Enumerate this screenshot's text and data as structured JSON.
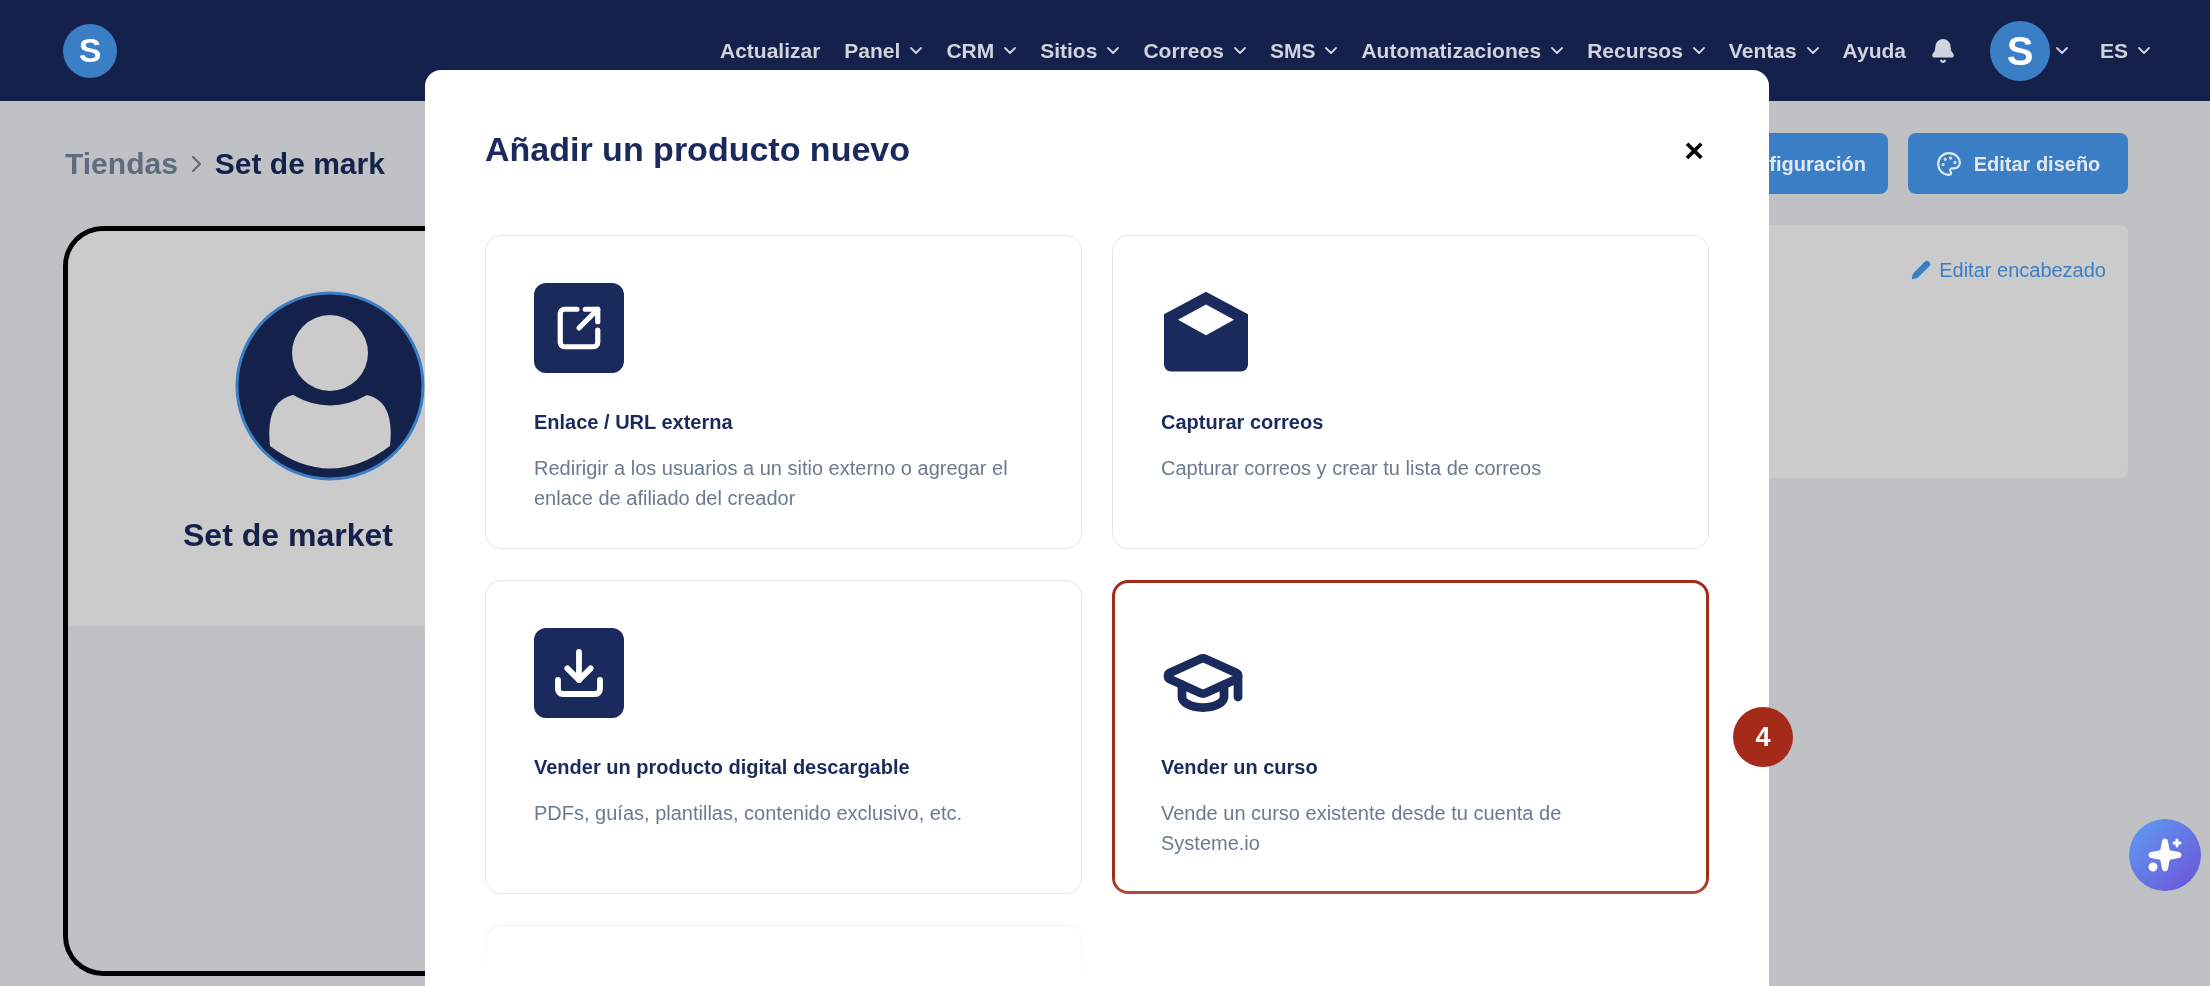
{
  "nav": {
    "items": [
      {
        "label": "Actualizar",
        "dropdown": false
      },
      {
        "label": "Panel",
        "dropdown": true
      },
      {
        "label": "CRM",
        "dropdown": true
      },
      {
        "label": "Sitios",
        "dropdown": true
      },
      {
        "label": "Correos",
        "dropdown": true
      },
      {
        "label": "SMS",
        "dropdown": true
      },
      {
        "label": "Automatizaciones",
        "dropdown": true
      },
      {
        "label": "Recursos",
        "dropdown": true
      },
      {
        "label": "Ventas",
        "dropdown": true
      },
      {
        "label": "Ayuda",
        "dropdown": false
      }
    ],
    "logo": "S",
    "avatar": "S",
    "language": "ES"
  },
  "breadcrumb": [
    "Tiendas",
    "Set de mark"
  ],
  "store_card": {
    "title": "Set de market"
  },
  "actions": [
    "figuración",
    "Editar diseño"
  ],
  "header_panel": {
    "link": "Editar encabezado"
  },
  "modal": {
    "title": "Añadir un producto nuevo",
    "close": "×",
    "options": [
      {
        "kind": "link",
        "title": "Enlace / URL externa",
        "description": "Redirigir a los usuarios a un sitio externo o agregar el enlace de afiliado del creador",
        "selected": false
      },
      {
        "kind": "email",
        "title": "Capturar correos",
        "description": "Capturar correos y crear tu lista de correos",
        "selected": false
      },
      {
        "kind": "download",
        "title": "Vender un producto digital descargable",
        "description": "PDFs, guías, plantillas, contenido exclusivo, etc.",
        "selected": false
      },
      {
        "kind": "course",
        "title": "Vender un curso",
        "description": "Vende un curso existente desde tu cuenta de Systeme.io",
        "selected": true
      }
    ]
  },
  "step_badge": "4"
}
